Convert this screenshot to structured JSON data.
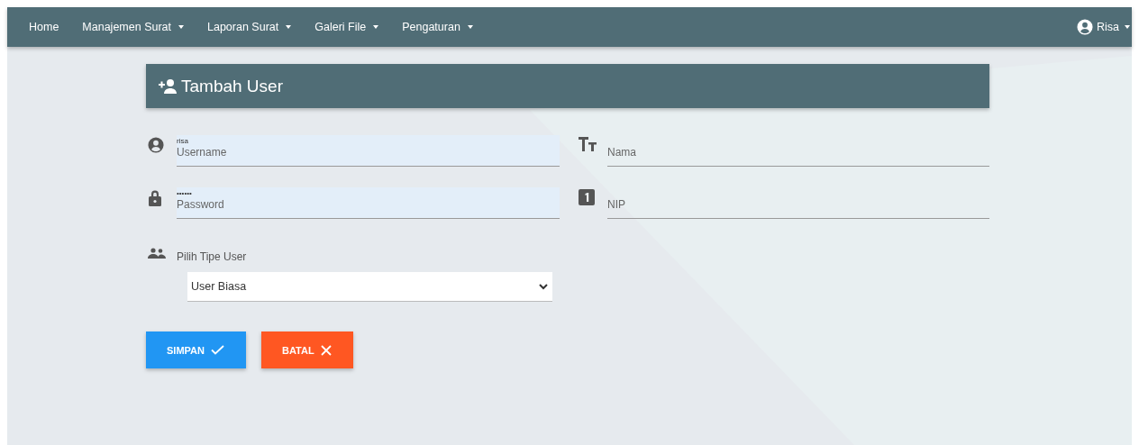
{
  "navbar": {
    "items": [
      {
        "label": "Home",
        "dropdown": false
      },
      {
        "label": "Manajemen Surat",
        "dropdown": true
      },
      {
        "label": "Laporan Surat",
        "dropdown": true
      },
      {
        "label": "Galeri File",
        "dropdown": true
      },
      {
        "label": "Pengaturan",
        "dropdown": true
      }
    ],
    "user": {
      "label": "Risa",
      "dropdown": true
    }
  },
  "card": {
    "title": "Tambah User"
  },
  "fields": [
    {
      "kind": "username",
      "label": "Username",
      "value": "risa",
      "autofilled": true
    },
    {
      "kind": "name",
      "label": "Nama",
      "autofilled": false
    },
    {
      "kind": "password",
      "label": "Password",
      "value": "••••••",
      "autofilled": true
    },
    {
      "kind": "number",
      "label": "NIP",
      "autofilled": false
    }
  ],
  "user_type": {
    "label": "Pilih Tipe User",
    "value": "User Biasa"
  },
  "buttons": [
    {
      "kind": "save",
      "label": "SIMPAN"
    },
    {
      "kind": "cancel",
      "label": "BATAL"
    }
  ]
}
